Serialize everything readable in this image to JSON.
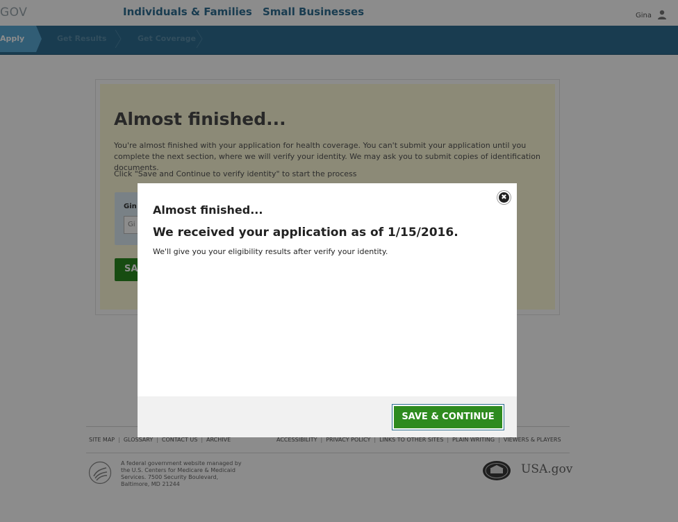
{
  "header": {
    "logo_text": "GOV",
    "nav": [
      "Individuals & Families",
      "Small Businesses"
    ],
    "user_name": "Gina"
  },
  "progress": {
    "steps": [
      "Apply",
      "Get Results",
      "Get Coverage"
    ]
  },
  "background_page": {
    "title": "Almost finished...",
    "intro": "You're almost finished with your application for health coverage. You can't submit your application until you complete the next section, where we will verify your identity. We may ask you to submit copies of identification documents.",
    "instruction": "Click \"Save and Continue to verify identity\" to start the process",
    "field_label": "Gin",
    "field_value": "Gi",
    "button_label": "SA"
  },
  "modal": {
    "title": "Almost finished...",
    "heading": "We received your application as of 1/15/2016.",
    "body": "We'll give you your eligibility results after verify your identity.",
    "close_symbol": "✖",
    "save_button": "SAVE & CONTINUE"
  },
  "footer": {
    "links_left": [
      "SITE MAP",
      "GLOSSARY",
      "CONTACT US",
      "ARCHIVE"
    ],
    "links_right": [
      "ACCESSIBILITY",
      "PRIVACY POLICY",
      "LINKS TO OTHER SITES",
      "PLAIN WRITING",
      "VIEWERS & PLAYERS"
    ],
    "federal_text": "A federal government website managed by the U.S. Centers for Medicare & Medicaid Services. 7500 Security Boulevard, Baltimore, MD 21244",
    "usa_gov": "USA.gov"
  },
  "colors": {
    "primary_blue": "#2e6e92",
    "active_step": "#5aa9d6",
    "save_green": "#2e8b1f",
    "card_bg": "#fffbd9"
  }
}
